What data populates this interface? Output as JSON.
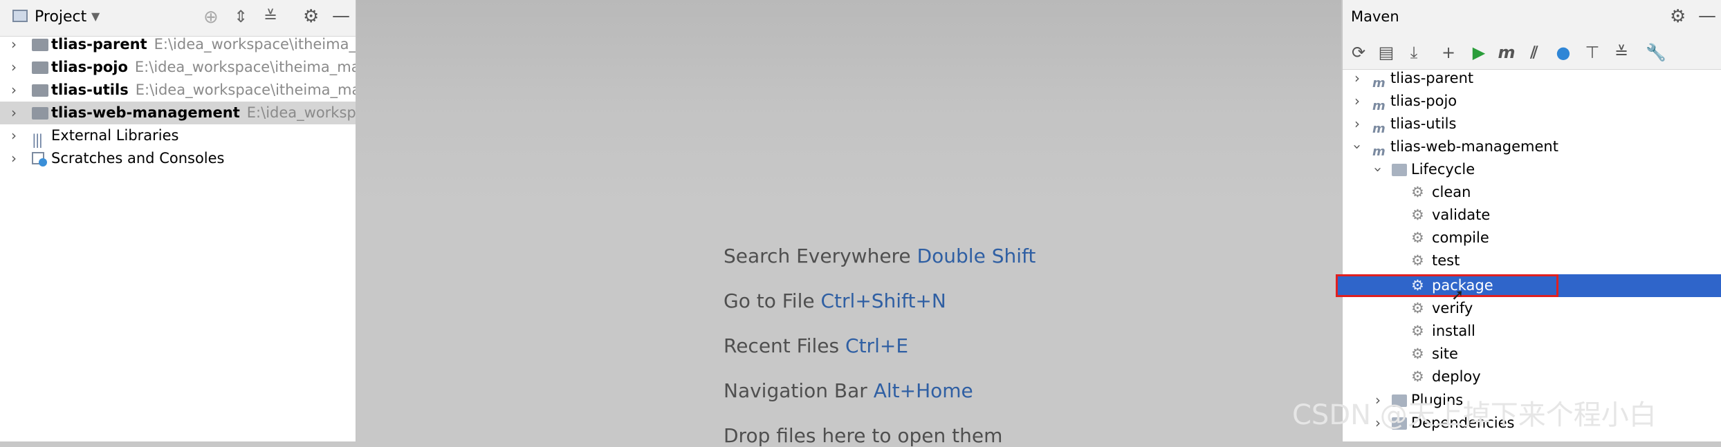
{
  "project": {
    "title": "Project",
    "items": [
      {
        "name": "tlias-parent",
        "path": "E:\\idea_workspace\\itheima_mave"
      },
      {
        "name": "tlias-pojo",
        "path": "E:\\idea_workspace\\itheima_maven_"
      },
      {
        "name": "tlias-utils",
        "path": "E:\\idea_workspace\\itheima_maven_"
      },
      {
        "name": "tlias-web-management",
        "path": "E:\\idea_workspace\\i"
      },
      {
        "name": "External Libraries"
      },
      {
        "name": "Scratches and Consoles"
      }
    ]
  },
  "editor": {
    "hints": [
      {
        "label": "Search Everywhere",
        "key": "Double Shift"
      },
      {
        "label": "Go to File",
        "key": "Ctrl+Shift+N"
      },
      {
        "label": "Recent Files",
        "key": "Ctrl+E"
      },
      {
        "label": "Navigation Bar",
        "key": "Alt+Home"
      },
      {
        "label": "Drop files here to open them"
      }
    ]
  },
  "maven": {
    "title": "Maven",
    "projects": [
      "tlias-parent",
      "tlias-pojo",
      "tlias-utils",
      "tlias-web-management"
    ],
    "lifecycle_label": "Lifecycle",
    "lifecycle": [
      "clean",
      "validate",
      "compile",
      "test",
      "package",
      "verify",
      "install",
      "site",
      "deploy"
    ],
    "selected": "package",
    "plugins_label": "Plugins",
    "dependencies_label": "Dependencies"
  },
  "watermark": "CSDN @天上掉下来个程小白",
  "colors": {
    "selection": "#2f65ca",
    "highlight_box": "#e02020",
    "shortcut": "#2f5fa3"
  }
}
